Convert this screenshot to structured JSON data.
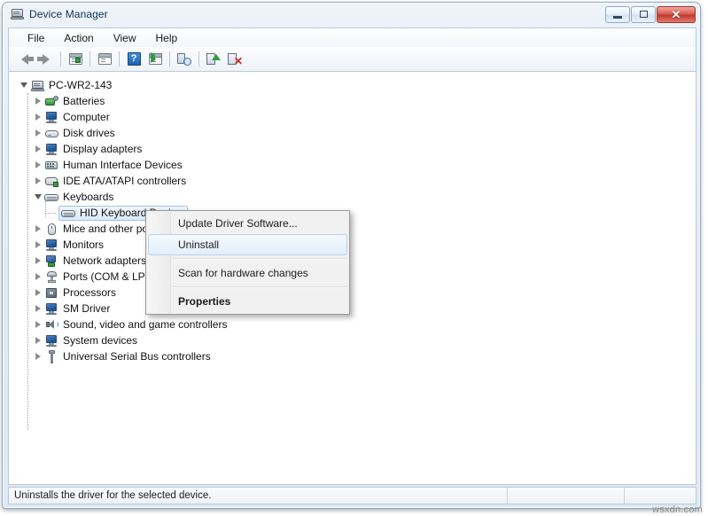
{
  "window": {
    "title": "Device Manager",
    "icon": "device-manager-icon",
    "controls": {
      "minimize": "–",
      "maximize": "□",
      "close": "✕"
    }
  },
  "menubar": {
    "items": [
      {
        "label": "File"
      },
      {
        "label": "Action"
      },
      {
        "label": "View"
      },
      {
        "label": "Help"
      }
    ]
  },
  "toolbar": {
    "buttons": [
      {
        "name": "back-button",
        "icon": "arrow-left-icon",
        "tooltip": "Back"
      },
      {
        "name": "forward-button",
        "icon": "arrow-right-icon",
        "tooltip": "Forward"
      },
      {
        "name": "show-hide-console-tree-button",
        "icon": "console-tree-icon",
        "tooltip": "Show/Hide Console Tree"
      },
      {
        "name": "properties-button",
        "icon": "properties-icon",
        "tooltip": "Properties"
      },
      {
        "name": "help-button",
        "icon": "help-icon",
        "tooltip": "Help",
        "glyph": "?"
      },
      {
        "name": "show-action-pane-button",
        "icon": "action-pane-icon",
        "tooltip": "Show/Hide Action Pane"
      },
      {
        "name": "scan-for-hardware-changes-button",
        "icon": "scan-hardware-icon",
        "tooltip": "Scan for hardware changes"
      },
      {
        "name": "update-driver-button",
        "icon": "update-driver-icon",
        "tooltip": "Update Driver Software"
      },
      {
        "name": "uninstall-device-button",
        "icon": "uninstall-device-icon",
        "tooltip": "Uninstall",
        "badge": "✕"
      }
    ]
  },
  "tree": {
    "root": {
      "label": "PC-WR2-143",
      "icon": "computer-root-icon",
      "expanded": true
    },
    "nodes": [
      {
        "label": "Batteries",
        "icon": "battery-icon",
        "expanded": false
      },
      {
        "label": "Computer",
        "icon": "computer-icon",
        "expanded": false
      },
      {
        "label": "Disk drives",
        "icon": "disk-drive-icon",
        "expanded": false
      },
      {
        "label": "Display adapters",
        "icon": "display-adapter-icon",
        "expanded": false
      },
      {
        "label": "Human Interface Devices",
        "icon": "hid-icon",
        "expanded": false
      },
      {
        "label": "IDE ATA/ATAPI controllers",
        "icon": "ide-controller-icon",
        "expanded": false
      },
      {
        "label": "Keyboards",
        "icon": "keyboard-icon",
        "expanded": true
      },
      {
        "label": "HID Keyboard Device",
        "icon": "keyboard-icon",
        "child": true,
        "selected": true
      },
      {
        "label": "Mice and other pointing devices",
        "icon": "mouse-icon",
        "expanded": false
      },
      {
        "label": "Monitors",
        "icon": "monitor-icon",
        "expanded": false
      },
      {
        "label": "Network adapters",
        "icon": "network-adapter-icon",
        "expanded": false
      },
      {
        "label": "Ports (COM & LPT)",
        "icon": "port-icon",
        "expanded": false
      },
      {
        "label": "Processors",
        "icon": "processor-icon",
        "expanded": false
      },
      {
        "label": "SM Driver",
        "icon": "computer-icon",
        "expanded": false
      },
      {
        "label": "Sound, video and game controllers",
        "icon": "sound-icon",
        "expanded": false
      },
      {
        "label": "System devices",
        "icon": "computer-icon",
        "expanded": false
      },
      {
        "label": "Universal Serial Bus controllers",
        "icon": "usb-icon",
        "expanded": false
      }
    ]
  },
  "context_menu": {
    "items": [
      {
        "label": "Update Driver Software...",
        "highlighted": false,
        "bold": false
      },
      {
        "label": "Uninstall",
        "highlighted": true,
        "bold": false
      },
      {
        "label": "Scan for hardware changes",
        "highlighted": false,
        "bold": false
      },
      {
        "label": "Properties",
        "highlighted": false,
        "bold": true
      }
    ]
  },
  "statusbar": {
    "message": "Uninstalls the driver for the selected device.",
    "cell2": "",
    "cell3": ""
  },
  "watermark": "wsxdn.com",
  "colors": {
    "accent": "#1f63ad",
    "selection_border": "#9fc3ea",
    "close_button": "#c0392c",
    "frame_border": "#8fa8c4"
  }
}
